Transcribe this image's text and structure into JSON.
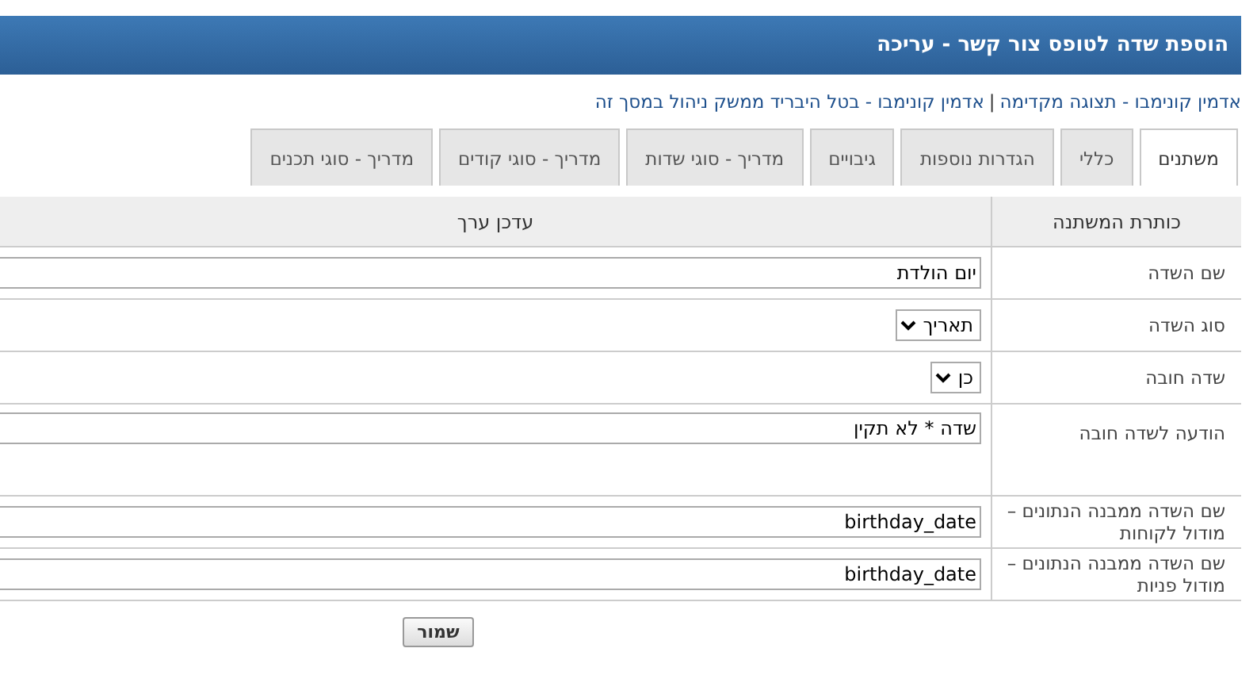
{
  "header": {
    "title": "הוספת שדה לטופס צור קשר - עריכה"
  },
  "breadcrumb": {
    "links": [
      "אדמין קונימבו - תצוגה מקדימה",
      "אדמין קונימבו - בטל היבריד ממשק ניהול במסך זה"
    ],
    "separator": "|"
  },
  "tabs": [
    {
      "label": "משתנים",
      "selected": true
    },
    {
      "label": "כללי",
      "selected": false
    },
    {
      "label": "הגדרות נוספות",
      "selected": false
    },
    {
      "label": "גיבויים",
      "selected": false
    },
    {
      "label": "מדריך - סוגי שדות",
      "selected": false
    },
    {
      "label": "מדריך - סוגי קודים",
      "selected": false
    },
    {
      "label": "מדריך - סוגי תכנים",
      "selected": false
    }
  ],
  "table": {
    "columns": [
      "כותרת המשתנה",
      "עדכן ערך"
    ],
    "rows": [
      {
        "label": "שם השדה",
        "kind": "text",
        "value": "יום הולדת",
        "tall": false
      },
      {
        "label": "סוג השדה",
        "kind": "select",
        "value": "תאריך",
        "tall": false
      },
      {
        "label": "שדה חובה",
        "kind": "select",
        "value": "כן",
        "tall": false
      },
      {
        "label": "הודעה לשדה חובה",
        "kind": "text",
        "value": "שדה * לא תקין",
        "tall": true
      },
      {
        "label": "שם השדה ממבנה הנתונים – מודול לקוחות",
        "kind": "text",
        "value": "birthday_date",
        "tall": false
      },
      {
        "label": "שם השדה ממבנה הנתונים – מודול פניות",
        "kind": "text",
        "value": "birthday_date",
        "tall": false
      }
    ]
  },
  "buttons": [
    "שמור"
  ]
}
